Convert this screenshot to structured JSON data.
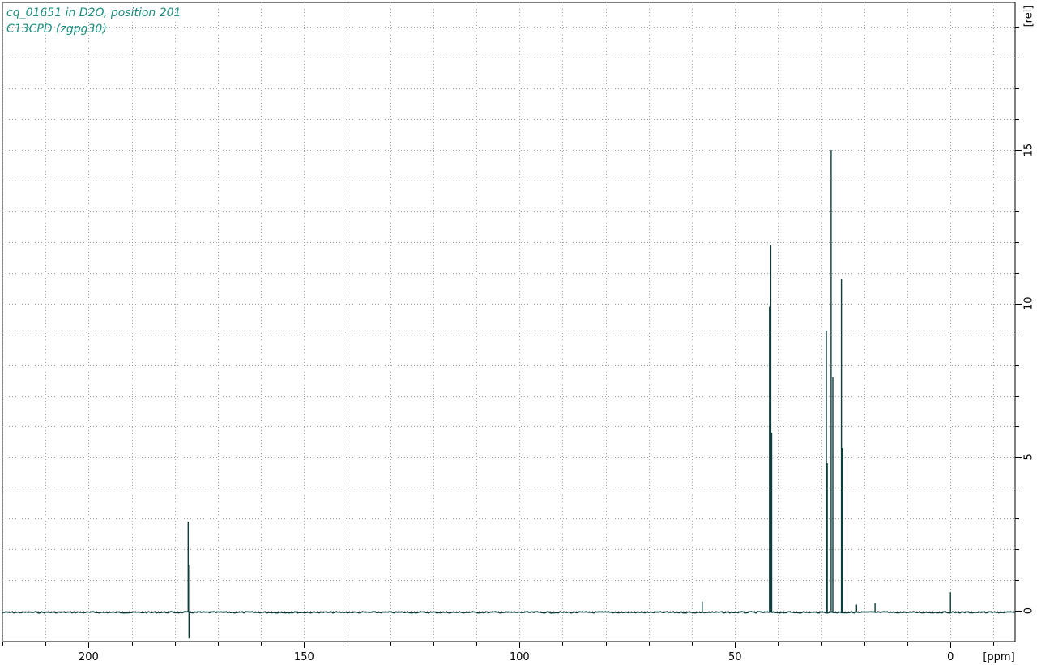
{
  "header": {
    "line1": "cq_01651 in D2O, position 201",
    "line2": "C13CPD (zgpg30)"
  },
  "colors": {
    "spectrum": "#0b3d3a",
    "title": "#1a8f7f",
    "grid": "#a0a0a0",
    "axis": "#000000"
  },
  "chart_data": {
    "type": "line",
    "title": "",
    "xlabel": "[ppm]",
    "ylabel": "[rel]",
    "x_reversed": true,
    "xlim": [
      -15.0,
      220.0
    ],
    "ylim": [
      -1.0,
      19.8
    ],
    "x_major_ticks": [
      200,
      150,
      100,
      50,
      0
    ],
    "x_minor_step": 10,
    "y_major_ticks": [
      0,
      5,
      10,
      15
    ],
    "y_minor_step": 1,
    "grid": true,
    "baseline": -0.05,
    "peaks": [
      {
        "x": 176.9,
        "y": 2.9,
        "type": "up"
      },
      {
        "x": 176.8,
        "y": 1.5,
        "type": "up"
      },
      {
        "x": 176.7,
        "y": -0.9,
        "type": "down"
      },
      {
        "x": 57.6,
        "y": 0.3,
        "type": "up"
      },
      {
        "x": 42.0,
        "y": 9.9,
        "type": "up"
      },
      {
        "x": 41.7,
        "y": 11.9,
        "type": "up"
      },
      {
        "x": 41.5,
        "y": 5.8,
        "type": "up"
      },
      {
        "x": 28.8,
        "y": 9.1,
        "type": "up"
      },
      {
        "x": 28.6,
        "y": 4.8,
        "type": "up"
      },
      {
        "x": 27.7,
        "y": 15.0,
        "type": "up"
      },
      {
        "x": 27.3,
        "y": 7.6,
        "type": "up"
      },
      {
        "x": 25.3,
        "y": 10.8,
        "type": "up"
      },
      {
        "x": 25.1,
        "y": 5.3,
        "type": "up"
      },
      {
        "x": 21.8,
        "y": 0.2,
        "type": "up"
      },
      {
        "x": 17.5,
        "y": 0.25,
        "type": "up"
      },
      {
        "x": 0.0,
        "y": 0.6,
        "type": "up"
      }
    ]
  }
}
